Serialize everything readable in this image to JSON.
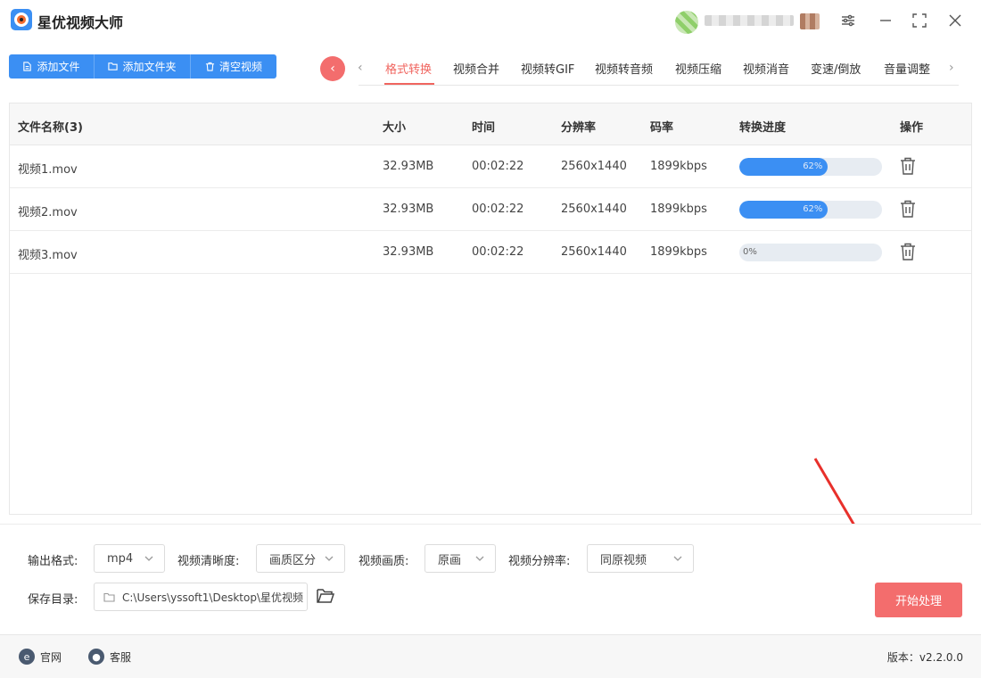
{
  "app": {
    "title": "星优视频大师"
  },
  "window": {
    "settings_icon": "sliders-icon",
    "minimize_icon": "minimize-icon",
    "maximize_icon": "maximize-icon",
    "close_icon": "close-icon"
  },
  "toolbar": {
    "buttons": [
      {
        "label": "添加文件",
        "icon": "add-file-icon"
      },
      {
        "label": "添加文件夹",
        "icon": "add-folder-icon"
      },
      {
        "label": "清空视频",
        "icon": "trash-icon"
      }
    ],
    "accent_color": "#3b8ff3"
  },
  "tabs": {
    "items": [
      "格式转换",
      "视频合并",
      "视频转GIF",
      "视频转音频",
      "视频压缩",
      "视频消音",
      "变速/倒放",
      "音量调整"
    ],
    "active": "格式转换",
    "active_color": "#f0655f"
  },
  "table": {
    "headers": [
      "文件名称(3)",
      "大小",
      "时间",
      "分辨率",
      "码率",
      "转换进度",
      "操作"
    ],
    "rows": [
      {
        "name": "视频1.mov",
        "size": "32.93MB",
        "time": "00:02:22",
        "resolution": "2560x1440",
        "bitrate": "1899kbps",
        "progress": 0.62,
        "progress_label": "62%"
      },
      {
        "name": "视频2.mov",
        "size": "32.93MB",
        "time": "00:02:22",
        "resolution": "2560x1440",
        "bitrate": "1899kbps",
        "progress": 0.62,
        "progress_label": "62%"
      },
      {
        "name": "视频3.mov",
        "size": "32.93MB",
        "time": "00:02:22",
        "resolution": "2560x1440",
        "bitrate": "1899kbps",
        "progress": 0,
        "progress_label": "0%"
      }
    ]
  },
  "settings": {
    "format_label": "输出格式:",
    "format_value": "mp4",
    "clarity_label": "视频清晰度:",
    "clarity_value": "画质区分",
    "quality_label": "视频画质:",
    "quality_value": "原画",
    "resolution_label": "视频分辨率:",
    "resolution_value": "同原视频",
    "save_label": "保存目录:",
    "save_path": "C:\\Users\\yssoft1\\Desktop\\星优视频",
    "start_label": "开始处理",
    "start_color": "#f36d6d"
  },
  "status": {
    "website_label": "官网",
    "service_label": "客服",
    "version": "版本：v2.2.0.0"
  }
}
